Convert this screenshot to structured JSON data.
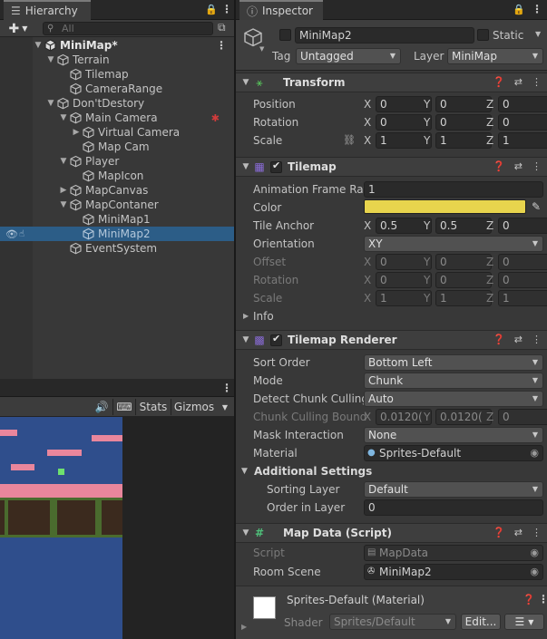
{
  "hierarchy": {
    "tab_label": "Hierarchy",
    "search_placeholder": "All",
    "rows": [
      {
        "label": "MiniMap*",
        "depth": 0,
        "arrow": "▼",
        "icon": "unity-scene-icon"
      },
      {
        "label": "Terrain",
        "depth": 1,
        "arrow": "▼",
        "icon": "gameobject-icon"
      },
      {
        "label": "Tilemap",
        "depth": 2,
        "arrow": "",
        "icon": "gameobject-icon"
      },
      {
        "label": "CameraRange",
        "depth": 2,
        "arrow": "",
        "icon": "gameobject-icon"
      },
      {
        "label": "Don'tDestory",
        "depth": 1,
        "arrow": "▼",
        "icon": "gameobject-icon"
      },
      {
        "label": "Main Camera",
        "depth": 2,
        "arrow": "▼",
        "icon": "gameobject-icon"
      },
      {
        "label": "Virtual Camera",
        "depth": 3,
        "arrow": "▶",
        "icon": "gameobject-icon"
      },
      {
        "label": "Map Cam",
        "depth": 3,
        "arrow": "",
        "icon": "gameobject-icon"
      },
      {
        "label": "Player",
        "depth": 2,
        "arrow": "▼",
        "icon": "gameobject-icon"
      },
      {
        "label": "MapIcon",
        "depth": 3,
        "arrow": "",
        "icon": "gameobject-icon"
      },
      {
        "label": "MapCanvas",
        "depth": 2,
        "arrow": "▶",
        "icon": "gameobject-icon"
      },
      {
        "label": "MapContaner",
        "depth": 2,
        "arrow": "▼",
        "icon": "gameobject-icon"
      },
      {
        "label": "MiniMap1",
        "depth": 3,
        "arrow": "",
        "icon": "gameobject-icon"
      },
      {
        "label": "MiniMap2",
        "depth": 3,
        "arrow": "",
        "icon": "gameobject-icon"
      },
      {
        "label": "EventSystem",
        "depth": 2,
        "arrow": "",
        "icon": "gameobject-icon"
      }
    ]
  },
  "game": {
    "stats_label": "Stats",
    "gizmos_label": "Gizmos"
  },
  "inspector": {
    "tab_label": "Inspector",
    "object_name": "MiniMap2",
    "static_label": "Static",
    "tag_label": "Tag",
    "tag_value": "Untagged",
    "layer_label": "Layer",
    "layer_value": "MiniMap",
    "transform": {
      "title": "Transform",
      "position_label": "Position",
      "rotation_label": "Rotation",
      "scale_label": "Scale",
      "position": [
        "0",
        "0",
        "0"
      ],
      "rotation": [
        "0",
        "0",
        "0"
      ],
      "scale": [
        "1",
        "1",
        "1"
      ]
    },
    "tilemap": {
      "title": "Tilemap",
      "anim_label": "Animation Frame Rate",
      "anim_value": "1",
      "color_label": "Color",
      "color_value": "#e8d44d",
      "anchor_label": "Tile Anchor",
      "anchor": [
        "0.5",
        "0.5",
        "0"
      ],
      "orientation_label": "Orientation",
      "orientation_value": "XY",
      "offset_label": "Offset",
      "offset": [
        "0",
        "0",
        "0"
      ],
      "rotation_label": "Rotation",
      "rotation": [
        "0",
        "0",
        "0"
      ],
      "scale_label": "Scale",
      "scale": [
        "1",
        "1",
        "1"
      ],
      "info_label": "Info"
    },
    "renderer": {
      "title": "Tilemap Renderer",
      "sort_order_label": "Sort Order",
      "sort_order_value": "Bottom Left",
      "mode_label": "Mode",
      "mode_value": "Chunk",
      "detect_label": "Detect Chunk Culling",
      "detect_value": "Auto",
      "bounds_label": "Chunk Culling Bound",
      "bounds": [
        "0.0120(",
        "0.0120(",
        "0"
      ],
      "mask_label": "Mask Interaction",
      "mask_value": "None",
      "material_label": "Material",
      "material_value": "Sprites-Default",
      "additional_label": "Additional Settings",
      "sorting_layer_label": "Sorting Layer",
      "sorting_layer_value": "Default",
      "order_label": "Order in Layer",
      "order_value": "0"
    },
    "mapdata": {
      "title": "Map Data (Script)",
      "script_label": "Script",
      "script_value": "MapData",
      "room_label": "Room Scene",
      "room_value": "MiniMap2"
    },
    "material": {
      "title": "Sprites-Default (Material)",
      "shader_label": "Shader",
      "shader_value": "Sprites/Default",
      "edit_label": "Edit..."
    },
    "axis_labels": [
      "X",
      "Y",
      "Z"
    ]
  }
}
